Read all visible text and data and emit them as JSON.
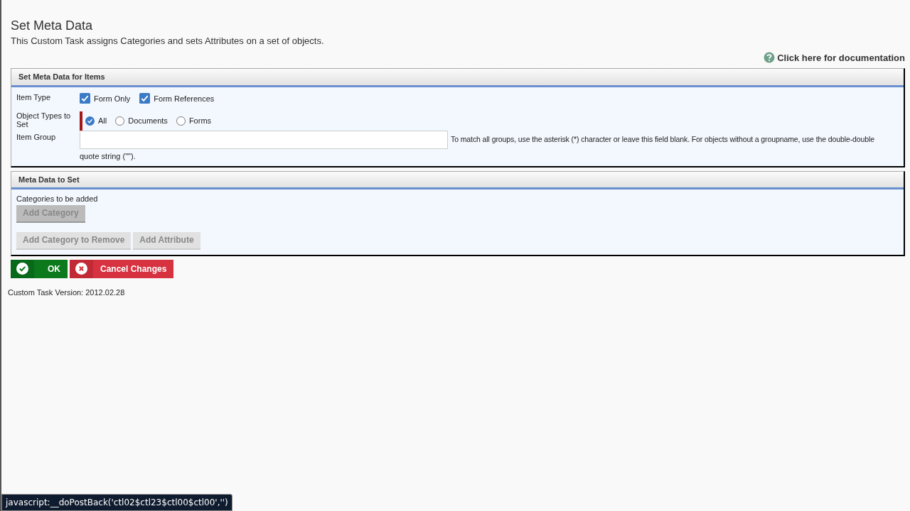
{
  "page": {
    "title": "Set Meta Data",
    "subtitle": "This Custom Task assigns Categories and sets Attributes on a set of objects.",
    "doc_link": "Click here for documentation"
  },
  "items_panel": {
    "title": "Set Meta Data for Items",
    "item_type": {
      "label": "Item Type",
      "options": [
        {
          "label": "Form Only",
          "checked": true
        },
        {
          "label": "Form References",
          "checked": true
        }
      ]
    },
    "object_types": {
      "label": "Object Types to Set",
      "required": true,
      "options": [
        {
          "label": "All",
          "selected": true
        },
        {
          "label": "Documents",
          "selected": false
        },
        {
          "label": "Forms",
          "selected": false
        }
      ]
    },
    "item_group": {
      "label": "Item Group",
      "hint_lines": [
        "To match all groups, use the asterisk (*) character or leave this field blank. For objects without a groupname, use the double-double",
        "quote string (\"\")."
      ]
    }
  },
  "meta_panel": {
    "title": "Meta Data to Set",
    "categories_label": "Categories to be added",
    "category_buttons": [
      {
        "label": "Add Category",
        "hovered": true
      }
    ],
    "other_buttons": [
      {
        "label": "Add Category to Remove",
        "hovered": false
      },
      {
        "label": "Add Attribute",
        "hovered": false
      }
    ]
  },
  "actions": [
    {
      "kind": "ok",
      "label": "OK"
    },
    {
      "kind": "cancel",
      "label": "Cancel Changes"
    }
  ],
  "version": "Custom Task Version: 2012.02.28",
  "status_bar": "javascript:__doPostBack('ctl02$ctl23$ctl00$ctl00','')"
}
